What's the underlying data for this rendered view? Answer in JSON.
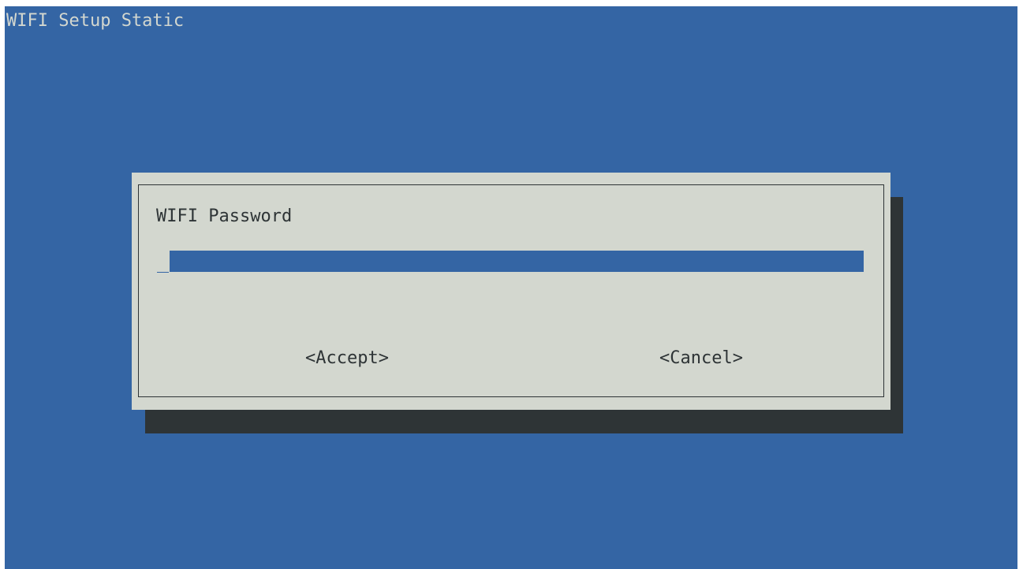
{
  "backtitle": "WIFI Setup Static",
  "dialog": {
    "title": "WIFI Password",
    "password_value": "",
    "buttons": {
      "accept": "<Accept>",
      "cancel": "<Cancel>"
    }
  },
  "colors": {
    "background": "#3465a4",
    "dialog": "#d3d7cf",
    "shadow": "#2e3436",
    "text": "#2e3436",
    "title_text": "#d3d7cf"
  }
}
